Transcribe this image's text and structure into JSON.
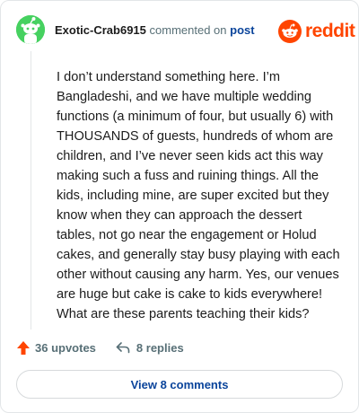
{
  "comment": {
    "username": "Exotic-Crab6915",
    "action_text": "commented on",
    "post_link_text": "post",
    "body": "I don’t understand something here. I’m Bangladeshi, and we have multiple wedding functions (a minimum of four, but usually 6) with THOUSANDS of guests, hundreds of whom are children, and I’ve never seen kids act this way making such a fuss and ruining things. All the kids, including mine, are super excited but they know when they can approach the dessert tables, not go near the engagement or Holud cakes, and generally stay busy playing with each other without causing any harm. Yes, our venues are huge but cake is cake to kids everywhere! What are these parents teaching their kids?"
  },
  "brand": {
    "logo_text": "reddit",
    "accent_color": "#ff4500",
    "avatar_color": "#46d160"
  },
  "actions": {
    "upvotes_label": "36 upvotes",
    "replies_label": "8 replies",
    "view_comments_label": "View 8 comments",
    "upvote_icon": "upvote-arrow-icon",
    "reply_icon": "reply-arrow-icon"
  }
}
